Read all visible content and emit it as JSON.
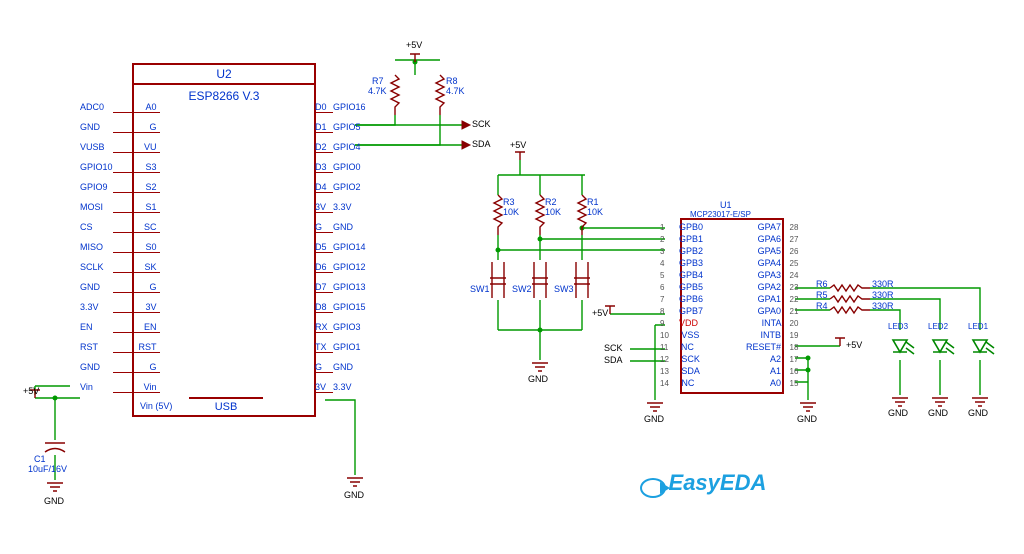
{
  "power": {
    "p5v": "+5V",
    "p3v3": "3.3V",
    "gnd": "GND"
  },
  "u2": {
    "ref": "U2",
    "title": "ESP8266 V.3",
    "usb": "USB",
    "left": [
      {
        "pin": "A0",
        "net": "ADC0"
      },
      {
        "pin": "G",
        "net": "GND"
      },
      {
        "pin": "VU",
        "net": "VUSB"
      },
      {
        "pin": "S3",
        "net": "GPIO10"
      },
      {
        "pin": "S2",
        "net": "GPIO9"
      },
      {
        "pin": "S1",
        "net": "MOSI"
      },
      {
        "pin": "SC",
        "net": "CS"
      },
      {
        "pin": "S0",
        "net": "MISO"
      },
      {
        "pin": "SK",
        "net": "SCLK"
      },
      {
        "pin": "G",
        "net": "GND"
      },
      {
        "pin": "3V",
        "net": "3.3V"
      },
      {
        "pin": "EN",
        "net": "EN"
      },
      {
        "pin": "RST",
        "net": "RST"
      },
      {
        "pin": "G",
        "net": "GND"
      },
      {
        "pin": "Vin",
        "net": "Vin"
      }
    ],
    "vin": "Vin (5V)",
    "right": [
      {
        "pin": "D0",
        "net": "GPIO16"
      },
      {
        "pin": "D1",
        "net": "GPIO5"
      },
      {
        "pin": "D2",
        "net": "GPIO4"
      },
      {
        "pin": "D3",
        "net": "GPIO0"
      },
      {
        "pin": "D4",
        "net": "GPIO2"
      },
      {
        "pin": "3V",
        "net": "3.3V"
      },
      {
        "pin": "G",
        "net": "GND"
      },
      {
        "pin": "D5",
        "net": "GPIO14"
      },
      {
        "pin": "D6",
        "net": "GPIO12"
      },
      {
        "pin": "D7",
        "net": "GPIO13"
      },
      {
        "pin": "D8",
        "net": "GPIO15"
      },
      {
        "pin": "RX",
        "net": "GPIO3"
      },
      {
        "pin": "TX",
        "net": "GPIO1"
      },
      {
        "pin": "G",
        "net": "GND"
      },
      {
        "pin": "3V",
        "net": "3.3V"
      }
    ]
  },
  "u1": {
    "ref": "U1",
    "part": "MCP23017-E/SP",
    "left": [
      {
        "n": "1",
        "name": "GPB0"
      },
      {
        "n": "2",
        "name": "GPB1"
      },
      {
        "n": "3",
        "name": "GPB2"
      },
      {
        "n": "4",
        "name": "GPB3"
      },
      {
        "n": "5",
        "name": "GPB4"
      },
      {
        "n": "6",
        "name": "GPB5"
      },
      {
        "n": "7",
        "name": "GPB6"
      },
      {
        "n": "8",
        "name": "GPB7"
      },
      {
        "n": "9",
        "name": "VDD",
        "color": "red"
      },
      {
        "n": "10",
        "name": "VSS"
      },
      {
        "n": "11",
        "name": "NC"
      },
      {
        "n": "12",
        "name": "SCK"
      },
      {
        "n": "13",
        "name": "SDA"
      },
      {
        "n": "14",
        "name": "NC"
      }
    ],
    "right": [
      {
        "n": "28",
        "name": "GPA7"
      },
      {
        "n": "27",
        "name": "GPA6"
      },
      {
        "n": "26",
        "name": "GPA5"
      },
      {
        "n": "25",
        "name": "GPA4"
      },
      {
        "n": "24",
        "name": "GPA3"
      },
      {
        "n": "23",
        "name": "GPA2"
      },
      {
        "n": "22",
        "name": "GPA1"
      },
      {
        "n": "21",
        "name": "GPA0"
      },
      {
        "n": "20",
        "name": "INTA"
      },
      {
        "n": "19",
        "name": "INTB"
      },
      {
        "n": "18",
        "name": "RESET#"
      },
      {
        "n": "17",
        "name": "A2"
      },
      {
        "n": "16",
        "name": "A1"
      },
      {
        "n": "15",
        "name": "A0"
      }
    ]
  },
  "resistors": {
    "r1": {
      "ref": "R1",
      "val": "10K"
    },
    "r2": {
      "ref": "R2",
      "val": "10K"
    },
    "r3": {
      "ref": "R3",
      "val": "10K"
    },
    "r4": {
      "ref": "R4",
      "val": "330R"
    },
    "r5": {
      "ref": "R5",
      "val": "330R"
    },
    "r6": {
      "ref": "R6",
      "val": "330R"
    },
    "r7": {
      "ref": "R7",
      "val": "4.7K"
    },
    "r8": {
      "ref": "R8",
      "val": "4.7K"
    }
  },
  "caps": {
    "c1": {
      "ref": "C1",
      "val": "10uF/16V"
    }
  },
  "switches": {
    "sw1": "SW1",
    "sw2": "SW2",
    "sw3": "SW3"
  },
  "leds": {
    "led1": "LED1",
    "led2": "LED2",
    "led3": "LED3"
  },
  "nets": {
    "sck": "SCK",
    "sda": "SDA"
  },
  "logo": "EasyEDA"
}
